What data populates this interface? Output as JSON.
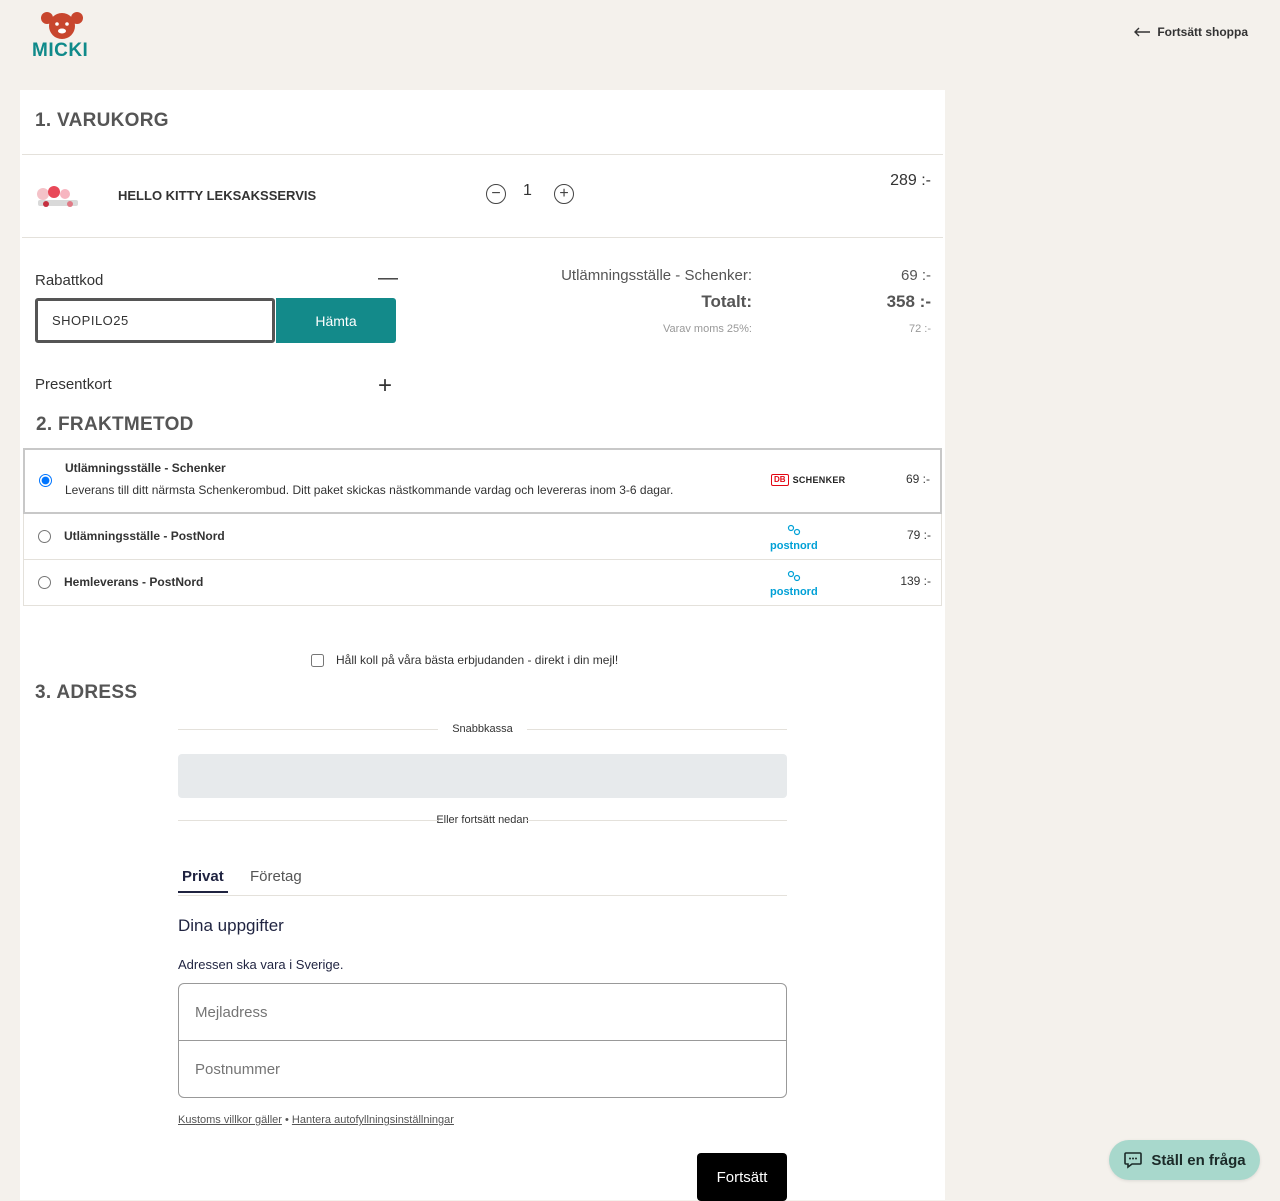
{
  "header": {
    "logo_text": "MICKI",
    "continue_shopping": "Fortsätt shoppa"
  },
  "cart": {
    "title": "1. VARUKORG",
    "item": {
      "name": "HELLO KITTY LEKSAKSSERVIS",
      "quantity": "1",
      "price": "289 :-"
    }
  },
  "discount": {
    "label": "Rabattkod",
    "value": "SHOPILO25",
    "button": "Hämta",
    "gift_card_label": "Presentkort"
  },
  "summary": {
    "shipping_label": "Utlämningsställe - Schenker:",
    "shipping_value": "69 :-",
    "total_label": "Totalt:",
    "total_value": "358 :-",
    "vat_label": "Varav moms 25%:",
    "vat_value": "72 :-"
  },
  "shipping": {
    "title": "2. FRAKTMETOD",
    "options": [
      {
        "name": "Utlämningsställe - Schenker",
        "description": "Leverans till ditt närmsta Schenkerombud. Ditt paket skickas nästkommande vardag och levereras inom 3-6 dagar.",
        "carrier_logo": "SCHENKER",
        "price": "69 :-"
      },
      {
        "name": "Utlämningsställe - PostNord",
        "carrier_logo": "postnord",
        "price": "79 :-"
      },
      {
        "name": "Hemleverans - PostNord",
        "carrier_logo": "postnord",
        "price": "139 :-"
      }
    ]
  },
  "newsletter": {
    "label": "Håll koll på våra bästa erbjudanden - direkt i din mejl!"
  },
  "address": {
    "title": "3. ADRESS",
    "fast_checkout_label": "Snabbkassa",
    "or_continue_label": "Eller fortsätt nedan",
    "tabs": [
      "Privat",
      "Företag"
    ],
    "details_title": "Dina uppgifter",
    "address_note": "Adressen ska vara i Sverige.",
    "email_placeholder": "Mejladress",
    "zip_placeholder": "Postnummer",
    "terms_link": "Kustoms villkor gäller",
    "separator": "•",
    "autofill_link": "Hantera autofyllningsinställningar",
    "submit": "Fortsätt"
  },
  "chat": {
    "label": "Ställ en fråga"
  },
  "colors": {
    "accent": "#138a8a",
    "logo": "#c8462e",
    "background": "#f4f1ec",
    "chat": "#a8d8cc"
  }
}
